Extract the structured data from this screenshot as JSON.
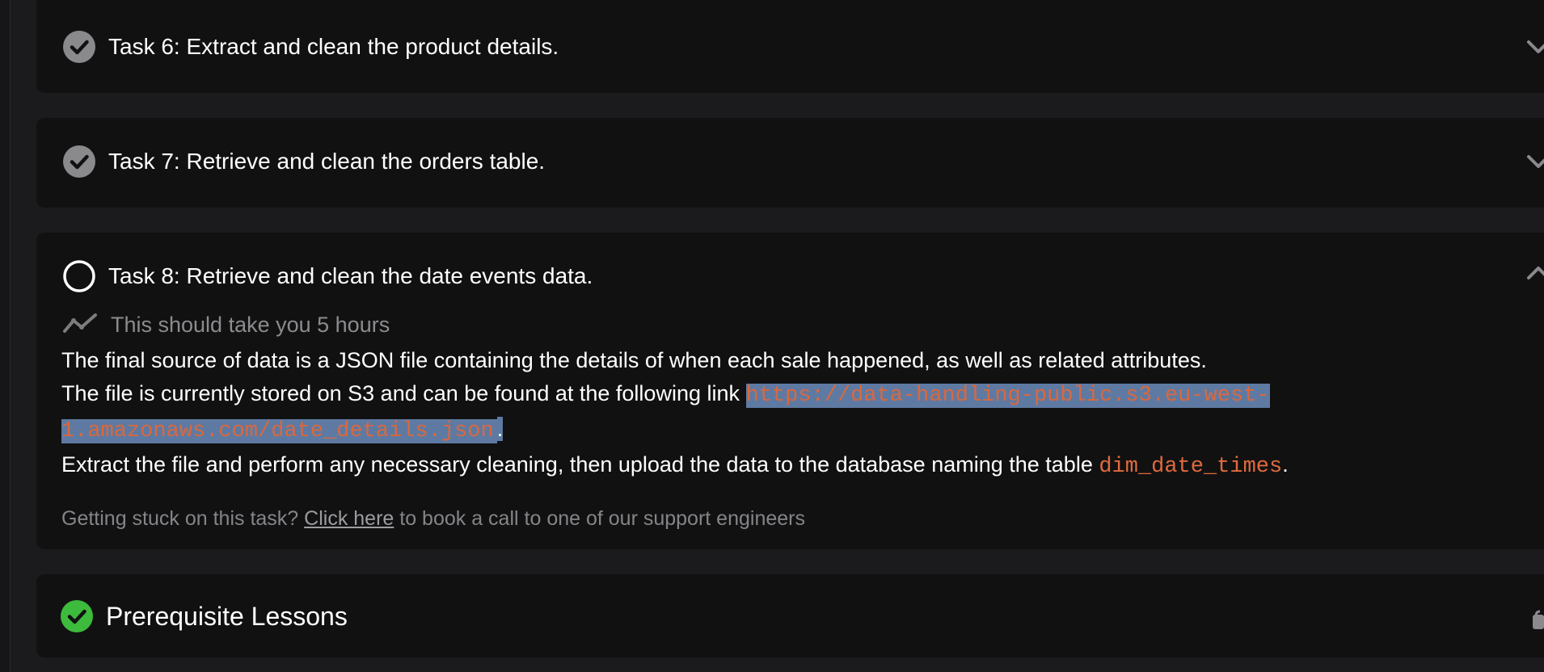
{
  "tasks": [
    {
      "title": "Task 6: Extract and clean the product details.",
      "status": "completed"
    },
    {
      "title": "Task 7: Retrieve and clean the orders table.",
      "status": "completed"
    },
    {
      "title": "Task 8: Retrieve and clean the date events data.",
      "status": "incomplete"
    }
  ],
  "expanded_task": {
    "duration": "This should take you 5 hours",
    "line1": "The final source of data is a JSON file containing the details of when each sale happened, as well as related attributes.",
    "line2_prefix": "The file is currently stored on S3 and can be found at the following link ",
    "link": "https://data-handling-public.s3.eu-west-1.amazonaws.com/date_details.json",
    "line2_suffix": ".",
    "line3_prefix": "Extract the file and perform any necessary cleaning, then upload the data to the database naming the table ",
    "table_name": "dim_date_times",
    "line3_suffix": ".",
    "help_prefix": "Getting stuck on this task? ",
    "help_link": "Click here",
    "help_suffix": " to book a call to one of our support engineers"
  },
  "prerequisites": {
    "title": "Prerequisite Lessons",
    "status": "completed"
  },
  "colors": {
    "background": "#1b1b1d",
    "card": "#111112",
    "accent_code": "#e06a3d",
    "selection": "#5e7aa3",
    "success": "#3dbb3d",
    "muted": "#8c8c8f"
  },
  "icons": {
    "completed": "check-circle-icon",
    "incomplete": "empty-circle-icon",
    "duration": "trend-line-icon",
    "collapse": "chevron-up-icon",
    "expand": "chevron-down-icon",
    "locked": "lock-icon"
  }
}
